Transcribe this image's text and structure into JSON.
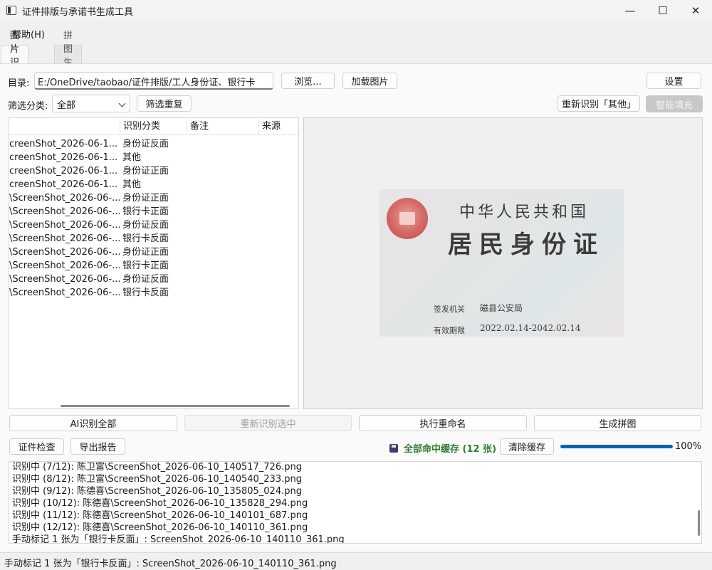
{
  "window": {
    "title": "证件排版与承诺书生成工具"
  },
  "menu": {
    "help": "帮助(H)"
  },
  "tabs": [
    {
      "label": "图片识别",
      "active": true
    },
    {
      "label": "拼图生成",
      "active": false
    }
  ],
  "toolbar": {
    "dir_label": "目录:",
    "dir_value": "E:/OneDrive/taobao/证件排版/工人身份证、银行卡",
    "browse": "浏览...",
    "load_images": "加载图片",
    "settings": "设置",
    "filter_label": "筛选分类:",
    "filter_value": "全部",
    "filter_dup": "筛选重复",
    "rerecognize_other": "重新识别「其他」",
    "smart_fill": "智能填充"
  },
  "table": {
    "headers": [
      "",
      "识别分类",
      "备注",
      "来源"
    ],
    "rows": [
      {
        "name": "creenShot_2026-06-1...",
        "category": "身份证反面"
      },
      {
        "name": "creenShot_2026-06-1...",
        "category": "其他"
      },
      {
        "name": "creenShot_2026-06-1...",
        "category": "身份证正面"
      },
      {
        "name": "creenShot_2026-06-1...",
        "category": "其他"
      },
      {
        "name": "\\ScreenShot_2026-06-...",
        "category": "身份证正面"
      },
      {
        "name": "\\ScreenShot_2026-06-...",
        "category": "银行卡正面"
      },
      {
        "name": "\\ScreenShot_2026-06-...",
        "category": "身份证反面"
      },
      {
        "name": "\\ScreenShot_2026-06-...",
        "category": "银行卡反面"
      },
      {
        "name": "\\ScreenShot_2026-06-...",
        "category": "身份证正面"
      },
      {
        "name": "\\ScreenShot_2026-06-...",
        "category": "银行卡正面"
      },
      {
        "name": "\\ScreenShot_2026-06-...",
        "category": "身份证反面"
      },
      {
        "name": "\\ScreenShot_2026-06-...",
        "category": "银行卡反面"
      }
    ]
  },
  "preview": {
    "country": "中华人民共和国",
    "card_title": "居民身份证",
    "issuer_label": "签发机关",
    "issuer_value": "磁县公安局",
    "validity_label": "有效期限",
    "validity_value": "2022.02.14-2042.02.14"
  },
  "actions": {
    "ai_recognize_all": "AI识别全部",
    "rerecognize_selected": "重新识别选中",
    "execute_rename": "执行重命名",
    "generate_collage": "生成拼图",
    "id_check": "证件检查",
    "export_report": "导出报告",
    "cache_status": "全部命中缓存 (12 张)",
    "clear_cache": "清除缓存",
    "progress_text": "100%"
  },
  "progress": {
    "value": 1.0,
    "color": "#0b63b0"
  },
  "log": [
    "识别中 (7/12): 陈卫富\\ScreenShot_2026-06-10_140517_726.png",
    "识别中 (8/12): 陈卫富\\ScreenShot_2026-06-10_140540_233.png",
    "识别中 (9/12): 陈德喜\\ScreenShot_2026-06-10_135805_024.png",
    "识别中 (10/12): 陈德喜\\ScreenShot_2026-06-10_135828_294.png",
    "识别中 (11/12): 陈德喜\\ScreenShot_2026-06-10_140101_687.png",
    "识别中 (12/12): 陈德喜\\ScreenShot_2026-06-10_140110_361.png",
    "手动标记 1 张为「银行卡反面」: ScreenShot_2026-06-10_140110_361.png"
  ],
  "status_bar": {
    "text": "手动标记 1 张为「银行卡反面」: ScreenShot_2026-06-10_140110_361.png"
  }
}
